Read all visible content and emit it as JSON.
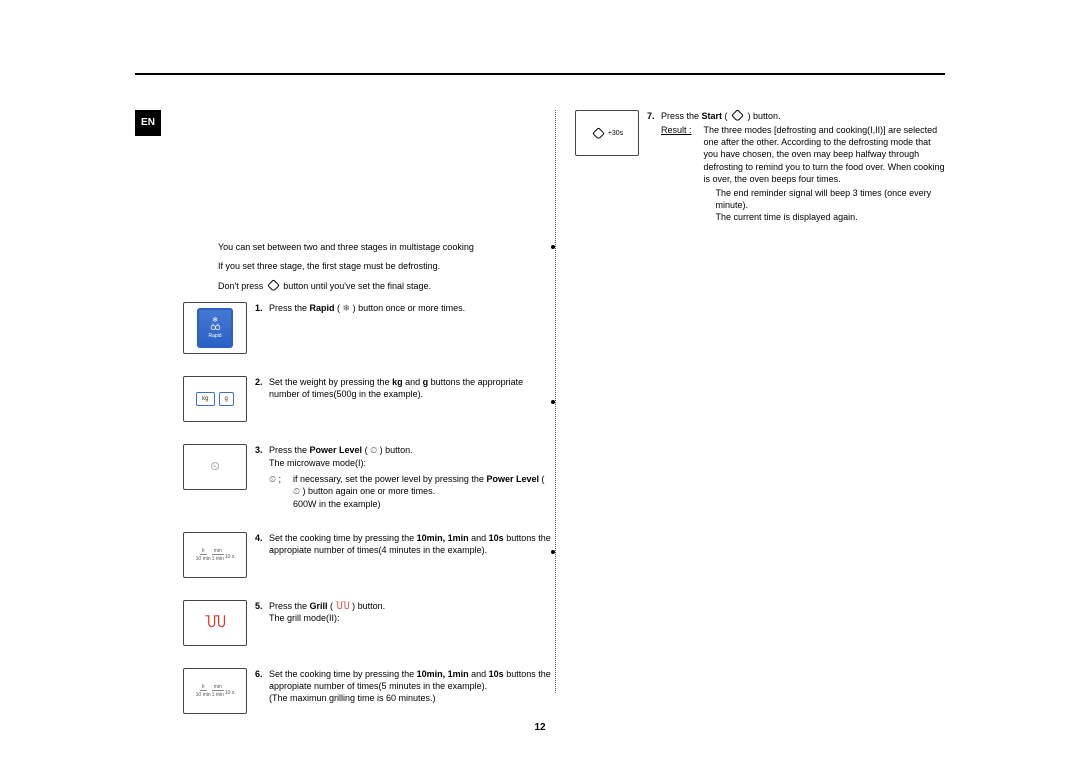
{
  "badge": "EN",
  "intro": {
    "line1": "You can set between two and three stages in multistage cooking",
    "line2": "If you set three stage, the first stage must be defrosting.",
    "line3_a": "Don't press ",
    "line3_b": " button until you've set the final stage."
  },
  "steps": {
    "s1": {
      "num": "1.",
      "a": "Press the ",
      "b": "Rapid",
      "c": " ( ",
      "d": " ) button once or more times.",
      "icon_label": "Rapid"
    },
    "s2": {
      "num": "2.",
      "text": "Set the weight by pressing the ",
      "bold1": "kg",
      "mid": " and ",
      "bold2": "g",
      "tail": " buttons the appropriate number of times(500g in the example).",
      "kg": "kg",
      "g": "g"
    },
    "s3": {
      "num": "3.",
      "a": "Press the ",
      "b": "Power Level",
      "c": " ( ",
      "d": " ) button.",
      "line2": "The microwave mode(I):",
      "sub_sep": ";",
      "sub_a": "if necessary, set the power level by pressing the ",
      "sub_b": "Power Level",
      "sub_c": " ( ",
      "sub_d": " ) button again one or more times.",
      "sub_e": "600W in the example)"
    },
    "s4": {
      "num": "4.",
      "a": "Set the cooking time by pressing the ",
      "b": "10min, 1min",
      "mid": " and ",
      "c": "10s",
      "tail": " buttons the appropiate number of times(4 minutes in the example).",
      "tb1u": "h",
      "tb1": "10 min",
      "tb2u": "min",
      "tb2": "1 min",
      "tb3": "10 s"
    },
    "s5": {
      "num": "5.",
      "a": "Press the ",
      "b": "Grill",
      "c": " ( ",
      "d": " ) button.",
      "line2": "The grill mode(II):"
    },
    "s6": {
      "num": "6.",
      "a": "Set the cooking time by pressing the ",
      "b": "10min, 1min",
      "mid": " and ",
      "c": "10s",
      "tail": " buttons the appropiate number of times(5 minutes in the example).",
      "line2": "(The maximun grilling time is 60 minutes.)"
    }
  },
  "right": {
    "s7": {
      "num": "7.",
      "a": "Press the ",
      "b": "Start",
      "c": " ( ",
      "d": " ) button.",
      "start_label": "+30s",
      "result_label": "Result :",
      "result_text": "The three modes [defrosting and cooking(I,II)] are selected one after the other. According to the defrosting mode that you have chosen, the oven may beep halfway through defrosting to remind you to turn the food over. When cooking is over, the oven beeps four times.",
      "result_line2": "The end reminder signal will beep 3 times (once every minute).",
      "result_line3": "The current time is displayed again."
    }
  },
  "page_number": "12"
}
